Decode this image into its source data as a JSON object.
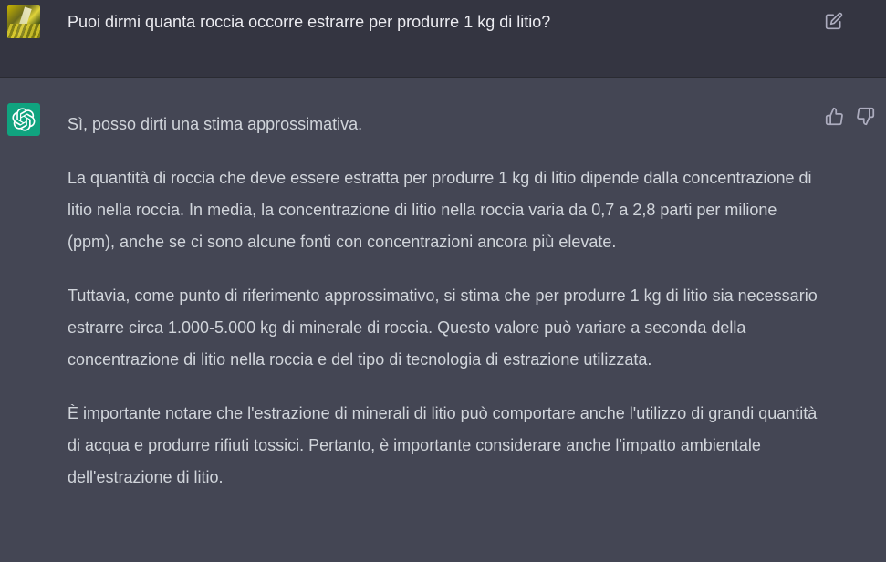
{
  "user_message": {
    "text": "Puoi dirmi quanta roccia occorre estrarre per produrre 1 kg di litio?"
  },
  "assistant_message": {
    "paragraphs": [
      "Sì, posso dirti una stima approssimativa.",
      "La quantità di roccia che deve essere estratta per produrre 1 kg di litio dipende dalla concentrazione di litio nella roccia. In media, la concentrazione di litio nella roccia varia da 0,7 a 2,8 parti per milione (ppm), anche se ci sono alcune fonti con concentrazioni ancora più elevate.",
      "Tuttavia, come punto di riferimento approssimativo, si stima che per produrre 1 kg di litio sia necessario estrarre circa 1.000-5.000 kg di minerale di roccia. Questo valore può variare a seconda della concentrazione di litio nella roccia e del tipo di tecnologia di estrazione utilizzata.",
      "È importante notare che l'estrazione di minerali di litio può comportare anche l'utilizzo di grandi quantità di acqua e produrre rifiuti tossici. Pertanto, è importante considerare anche l'impatto ambientale dell'estrazione di litio."
    ]
  },
  "icons": {
    "user_avatar": "user-avatar-photo",
    "edit": "edit-icon",
    "assistant_avatar": "openai-logo-icon",
    "thumb_up": "thumb-up-icon",
    "thumb_down": "thumb-down-icon"
  },
  "colors": {
    "user_bg": "#343541",
    "assistant_bg": "#444654",
    "logo_green": "#10a37f",
    "text": "#d1d5db"
  }
}
